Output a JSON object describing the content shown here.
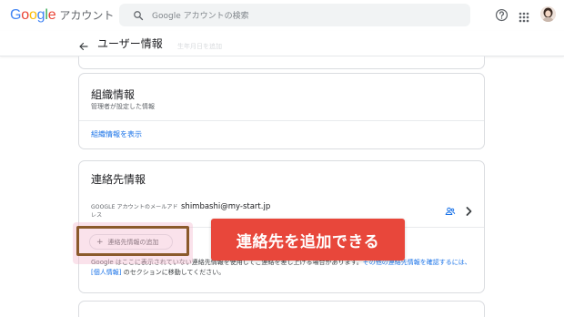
{
  "header": {
    "logo_google": "Google",
    "logo_product": "アカウント",
    "search_placeholder": "Google アカウントの検索"
  },
  "subheader": {
    "page_title": "ユーザー情報",
    "ghost_text": "生年月日を追加"
  },
  "org_card": {
    "title": "組織情報",
    "description": "管理者が設定した情報",
    "link": "組織情報を表示"
  },
  "contact_card": {
    "title": "連絡先情報",
    "email_label": "GOOGLE アカウントのメールアドレス",
    "email_value": "shimbashi@my-start.jp",
    "add_button": "連絡先情報の追加",
    "note_text": "Google はここに表示されていない連絡先情報を使用してご連絡を差し上げる場合があります。",
    "note_link1": "その他の連絡先情報を確認するには、",
    "note_link2": "[個人情報]",
    "note_end": " のセクションに移動してください。"
  },
  "callout": {
    "text": "連絡先を追加できる"
  },
  "colors": {
    "accent_link": "#1a73e8",
    "callout_bg": "#e8473b",
    "highlight_border": "#8b5a2b"
  }
}
